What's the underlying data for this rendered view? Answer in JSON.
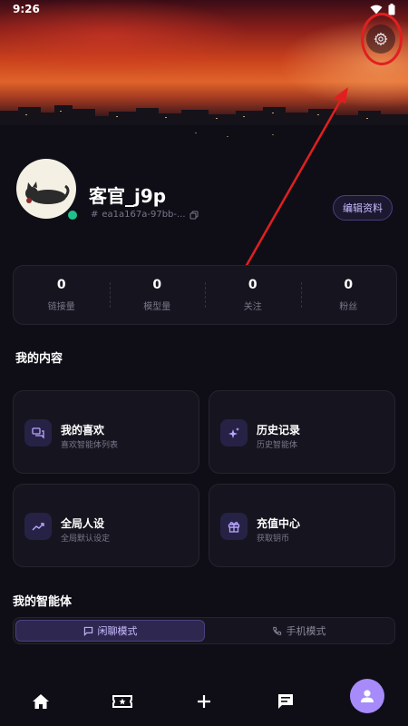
{
  "status_bar": {
    "time": "9:26"
  },
  "profile": {
    "username": "客官_j9p",
    "user_id": "ea1a167a-97bb-...",
    "edit_label": "编辑资料"
  },
  "stats": [
    {
      "value": "0",
      "label": "链接量"
    },
    {
      "value": "0",
      "label": "模型量"
    },
    {
      "value": "0",
      "label": "关注"
    },
    {
      "value": "0",
      "label": "粉丝"
    }
  ],
  "my_content": {
    "title": "我的内容",
    "cards": [
      {
        "title": "我的喜欢",
        "subtitle": "喜欢智能体列表",
        "icon": "chat-bubbles-icon"
      },
      {
        "title": "历史记录",
        "subtitle": "历史智能体",
        "icon": "sparkle-icon"
      },
      {
        "title": "全局人设",
        "subtitle": "全局默认设定",
        "icon": "trend-icon"
      },
      {
        "title": "充值中心",
        "subtitle": "获取钥币",
        "icon": "gift-icon"
      }
    ]
  },
  "my_agents": {
    "title": "我的智能体",
    "modes": [
      {
        "label": "闲聊模式",
        "active": true,
        "icon": "message-icon"
      },
      {
        "label": "手机模式",
        "active": false,
        "icon": "phone-icon"
      }
    ]
  },
  "bottom_nav": [
    "home-icon",
    "ticket-icon",
    "plus-icon",
    "message-icon",
    "profile-icon"
  ],
  "colors": {
    "background": "#0f0e17",
    "card": "#16151f",
    "accent": "#a78bfa",
    "online": "#1fc28a",
    "annotation": "#e02020"
  }
}
